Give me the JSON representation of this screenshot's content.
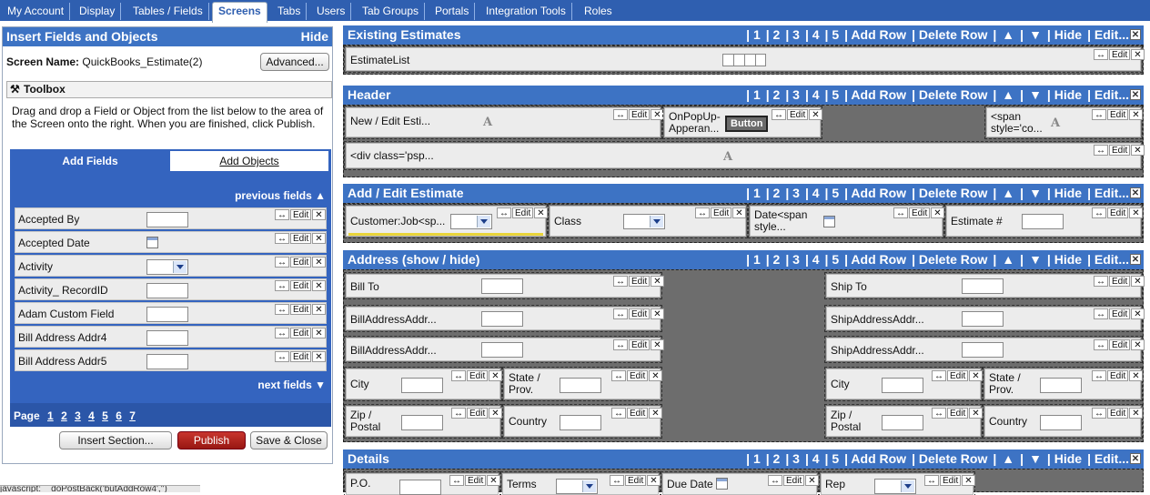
{
  "nav": {
    "tabs": [
      "My Account",
      "Display",
      "Tables / Fields",
      "Screens",
      "Tabs",
      "Users",
      "Tab Groups",
      "Portals",
      "Integration Tools",
      "Roles"
    ],
    "active": "Screens"
  },
  "left": {
    "title": "Insert Fields and Objects",
    "hide": "Hide",
    "screen_name_label": "Screen Name:",
    "screen_name_value": "QuickBooks_Estimate(2)",
    "advanced": "Advanced...",
    "toolbox": "Toolbox",
    "instructions": "Drag and drop a Field or Object from the list below to the area of the Screen onto the right. When you are finished, click Publish.",
    "tab_fields": "Add Fields",
    "tab_objects": "Add Objects",
    "previous": "previous fields",
    "next": "next fields",
    "fields": [
      "Accepted By",
      "Accepted Date",
      "Activity",
      "Activity_ RecordID",
      "Adam Custom Field",
      "Bill Address Addr4",
      "Bill Address Addr5"
    ],
    "page_label": "Page",
    "pages": [
      "1",
      "2",
      "3",
      "4",
      "5",
      "6",
      "7"
    ],
    "insert_section": "Insert Section...",
    "publish": "Publish",
    "save_close": "Save & Close"
  },
  "controls": {
    "move": "↔",
    "edit": "Edit",
    "x": "✕"
  },
  "section_tools": [
    "| 1",
    "| 2",
    "| 3",
    "| 4",
    "| 5",
    "| Add Row",
    "| Delete Row",
    "|",
    "|",
    "| Hide",
    "| Edit..."
  ],
  "sections": {
    "existing": {
      "title": "Existing Estimates",
      "item": "EstimateList"
    },
    "header": {
      "title": "Header",
      "c1": "New / Edit Esti...",
      "c2": "OnPopUp-Apperan...",
      "button": "Button",
      "c3": "<span style='co...",
      "c4": "<div class='psp..."
    },
    "addedit": {
      "title": "Add / Edit Estimate",
      "c1": "Customer:Job<sp...",
      "c2": "Class",
      "c3": "Date<span style...",
      "c4": "Estimate #"
    },
    "address": {
      "title": "Address (show / hide)",
      "bill_to": "Bill To",
      "bill_addr": "BillAddressAddr...",
      "city": "City",
      "state": "State / Prov.",
      "zip": "Zip / Postal",
      "country": "Country",
      "ship_to": "Ship To",
      "ship_addr": "ShipAddressAddr..."
    },
    "details": {
      "title": "Details",
      "c1": "P.O.",
      "c2": "Terms",
      "c3": "Due Date",
      "c4": "Rep"
    }
  },
  "status": "javascript:__doPostBack('butAddRow4','')"
}
